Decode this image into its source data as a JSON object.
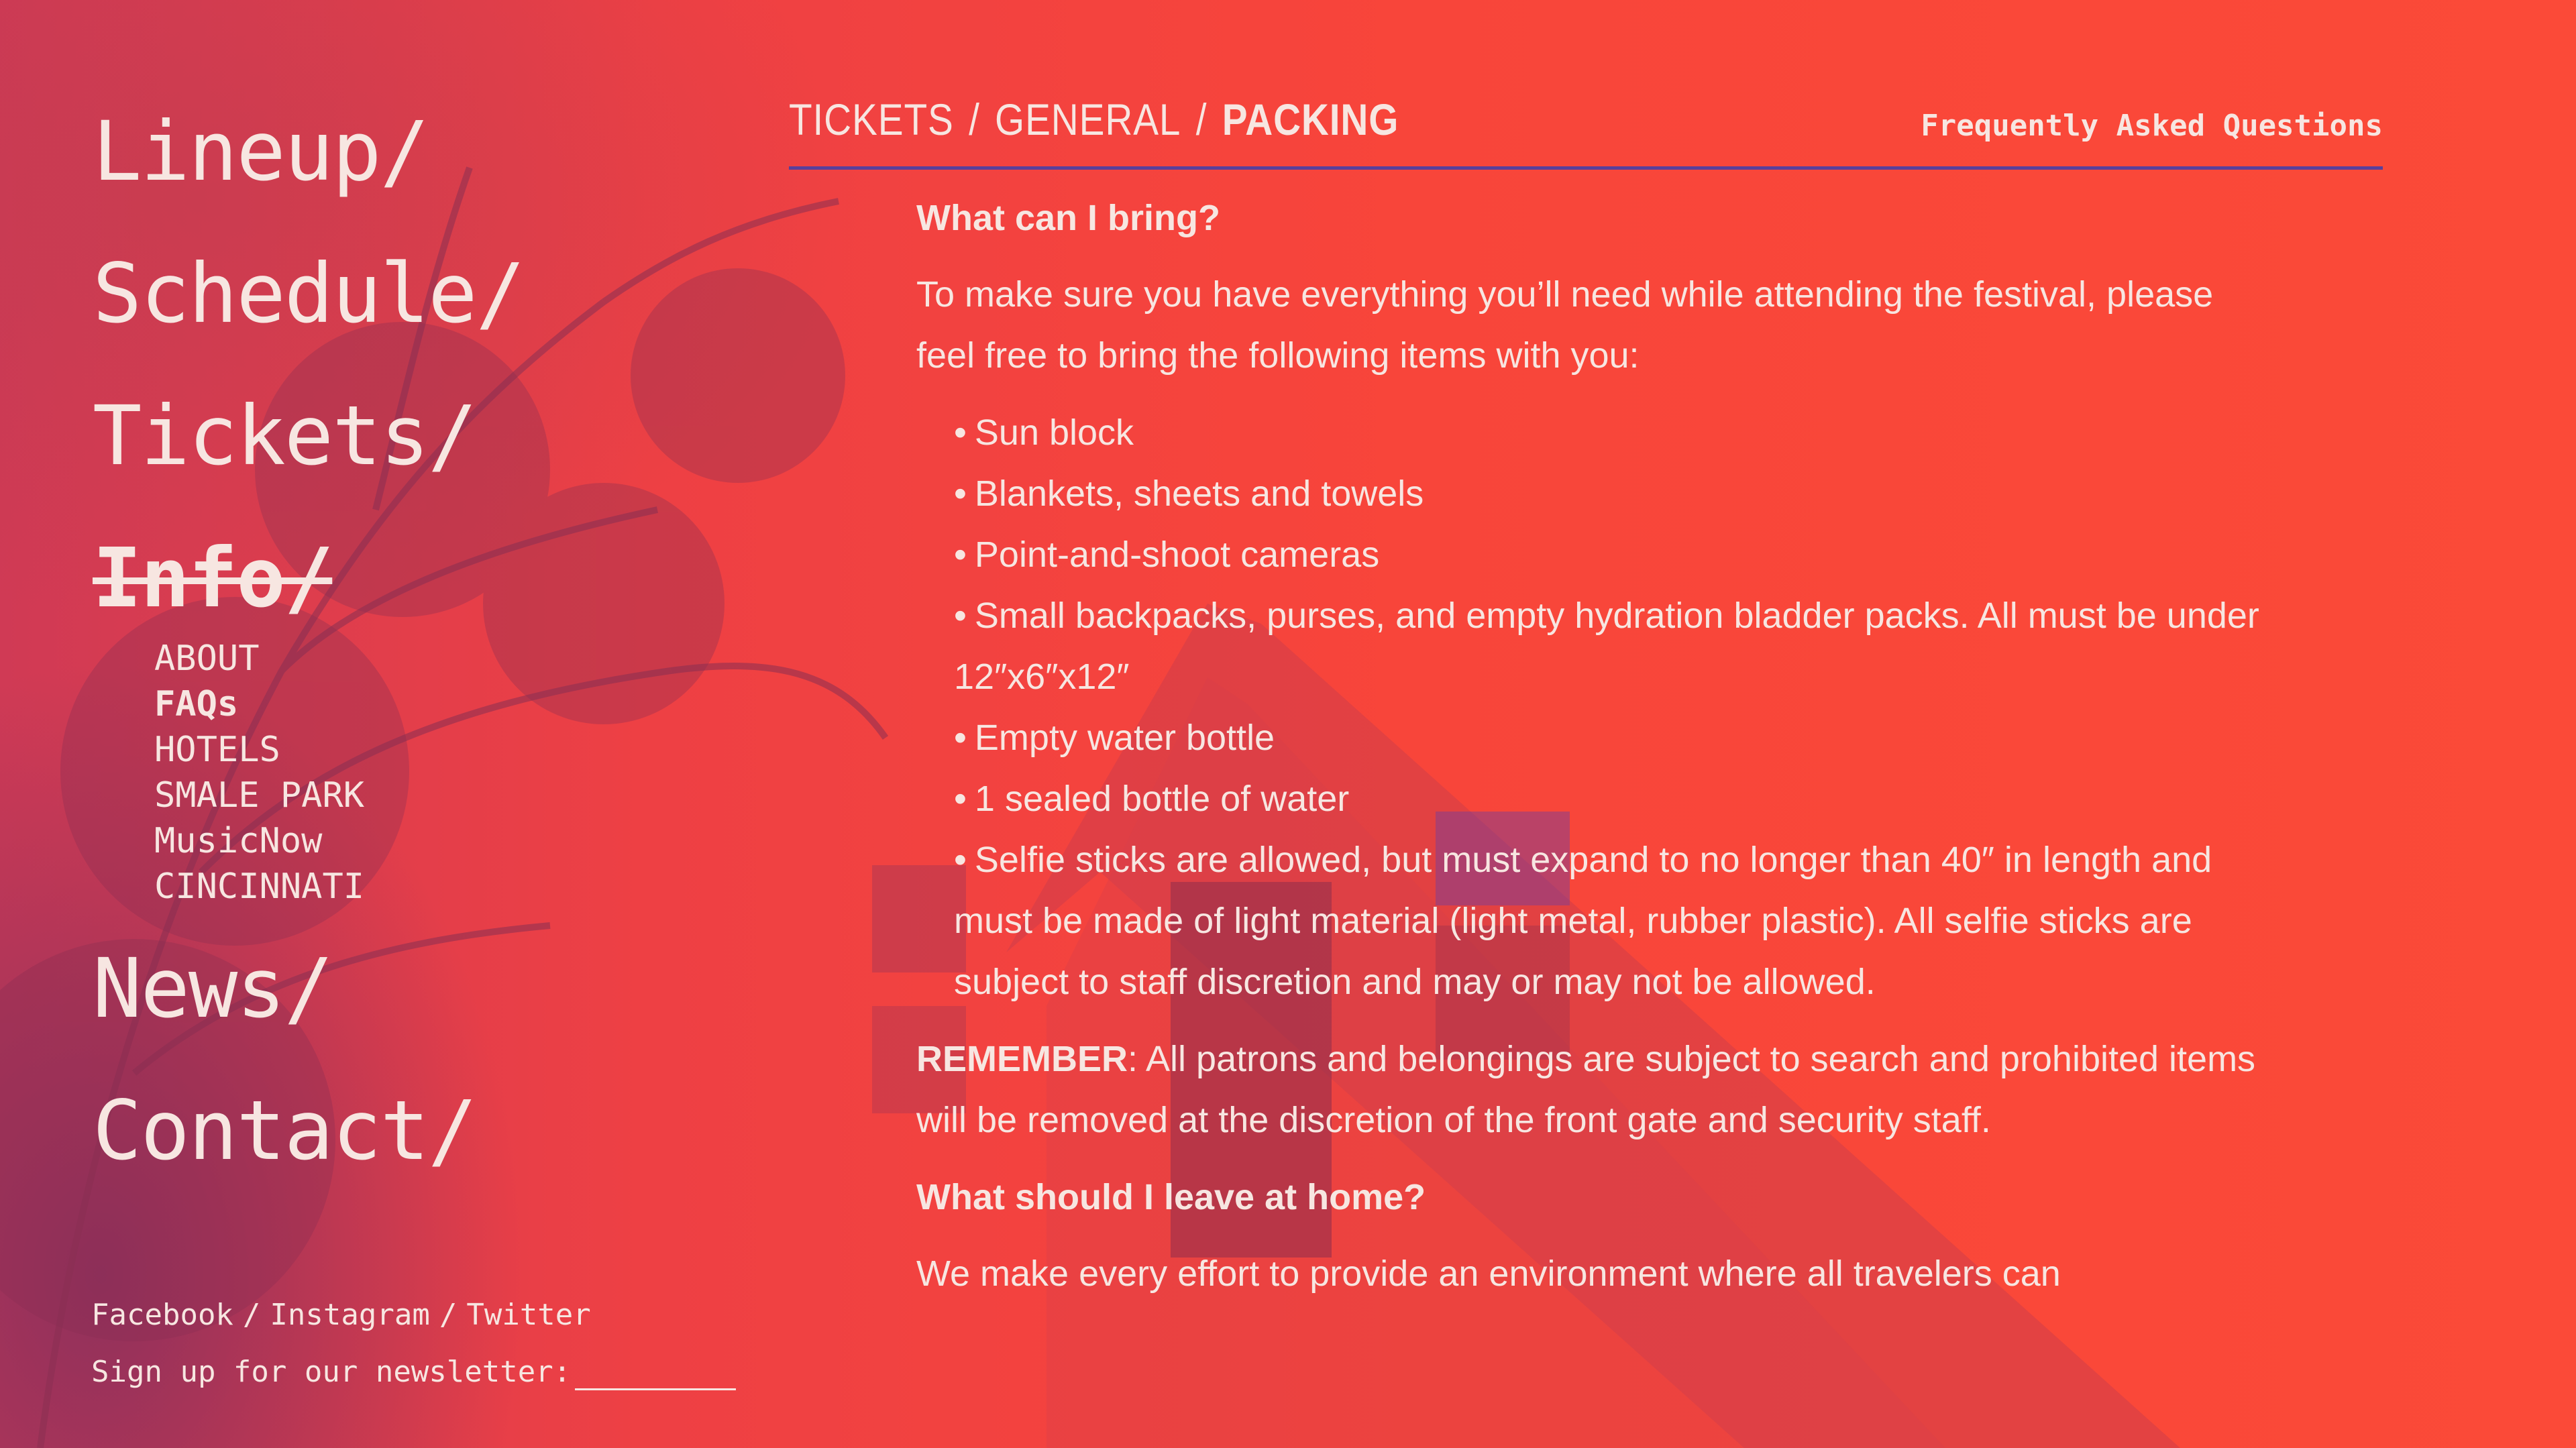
{
  "nav": {
    "items": [
      {
        "label": "Lineup/"
      },
      {
        "label": "Schedule/"
      },
      {
        "label": "Tickets/"
      },
      {
        "label": "Info/"
      },
      {
        "label": "News/"
      },
      {
        "label": "Contact/"
      }
    ],
    "active": "Info/",
    "sub_items": [
      {
        "label": "ABOUT"
      },
      {
        "label": "FAQs"
      },
      {
        "label": "HOTELS"
      },
      {
        "label": "SMALE PARK"
      },
      {
        "label": "MusicNow"
      },
      {
        "label": "CINCINNATI"
      }
    ],
    "active_sub": "FAQs"
  },
  "footer": {
    "social": [
      "Facebook",
      "Instagram",
      "Twitter"
    ],
    "separator": "/",
    "newsletter_label": "Sign up for our newsletter:",
    "newsletter_value": ""
  },
  "header": {
    "breadcrumbs": [
      "TICKETS",
      "GENERAL",
      "PACKING"
    ],
    "separator": "/",
    "faq_link": "Frequently Asked Questions"
  },
  "content": {
    "q1": "What can I bring?",
    "intro": "To make sure you have everything you’ll need while attending the festival, please feel free to bring the following items with you:",
    "bullet_symbol": "•",
    "items": [
      "Sun block",
      "Blankets, sheets and towels",
      "Point-and-shoot cameras",
      "Small backpacks, purses, and empty hydration bladder packs. All must be under 12″x6″x12″",
      "Empty water bottle",
      "1 sealed bottle of water",
      "Selfie sticks are allowed, but must expand to no longer than 40″ in length and must be made of light material (light metal, rubber plastic). All selfie sticks are subject to staff discretion and may or may not be allowed."
    ],
    "remember_label": "REMEMBER",
    "remember_text": ": All patrons and belongings are subject to search and prohibited items will be removed at the discretion of the front gate and security staff.",
    "q2": "What should I leave at home?",
    "leave_text": "We make every effort to provide an environment where all travelers can"
  },
  "colors": {
    "background": "#f6443a",
    "text": "#f7e6e1",
    "divider": "#5a3f9a",
    "shadow": "#7a2d5f"
  }
}
